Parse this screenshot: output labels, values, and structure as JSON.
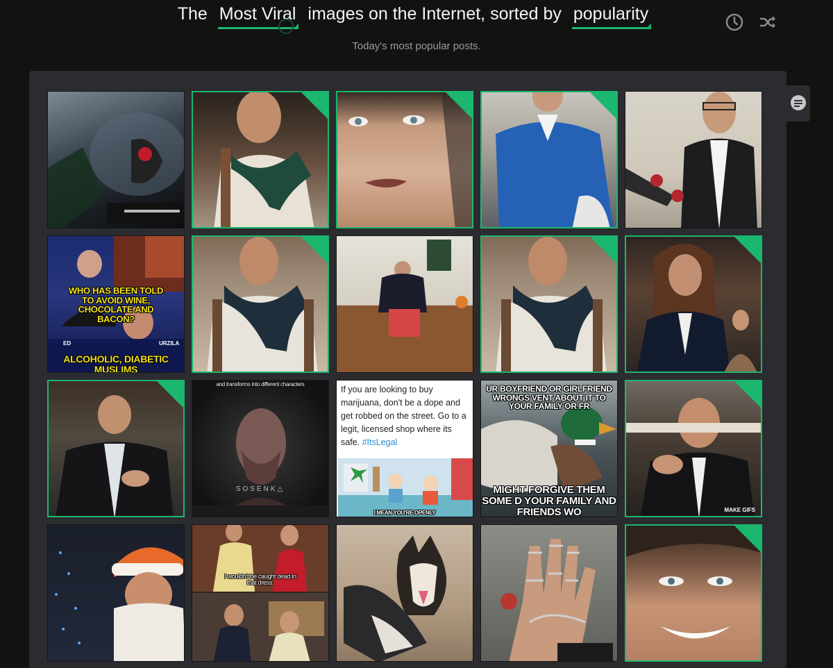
{
  "header": {
    "headline_prefix": "The",
    "headline_sort_a": "Most Viral",
    "headline_middle": "images on the Internet, sorted by",
    "headline_sort_b": "popularity",
    "subtitle": "Today's most popular posts."
  },
  "icons": {
    "clock": "clock-icon",
    "shuffle": "shuffle-icon",
    "chat": "chat-bubble-icon"
  },
  "colors": {
    "accent": "#1bb76e",
    "panel": "#2b2c2f",
    "background": "#121211"
  },
  "tiles": {
    "t6_cap_top": "WHO HAS BEEN TOLD TO AVOID WINE, CHOCOLATE AND BACON?",
    "t6_label_left": "ED",
    "t6_label_right": "URZILA",
    "t6_cap_bottom": "ALCOHOLIC, DIABETIC MUSLIMS",
    "t12_cap": "and transforms into different characters",
    "t12_logo": "SOSENK△",
    "t13_tweet": "If you are looking to buy marijuana, don't be a dope and get robbed on the street. Go to a legit, licensed shop where its safe.",
    "t13_tag": "#ItsLegal",
    "t13_bottom": "I MEAN YOU'RE OPENLY",
    "t14_cap_top": "UR BOYFRIEND OR GIRLFRIEND WRONGS VENT ABOUT IT TO YOUR FAMILY OR FR",
    "t14_cap_bottom": "MIGHT FORGIVE THEM SOME D YOUR FAMILY AND FRIENDS WO",
    "t15_cap": "MAKE GIFS",
    "t17_cap": "I wouldn't be caught dead in that dress."
  }
}
